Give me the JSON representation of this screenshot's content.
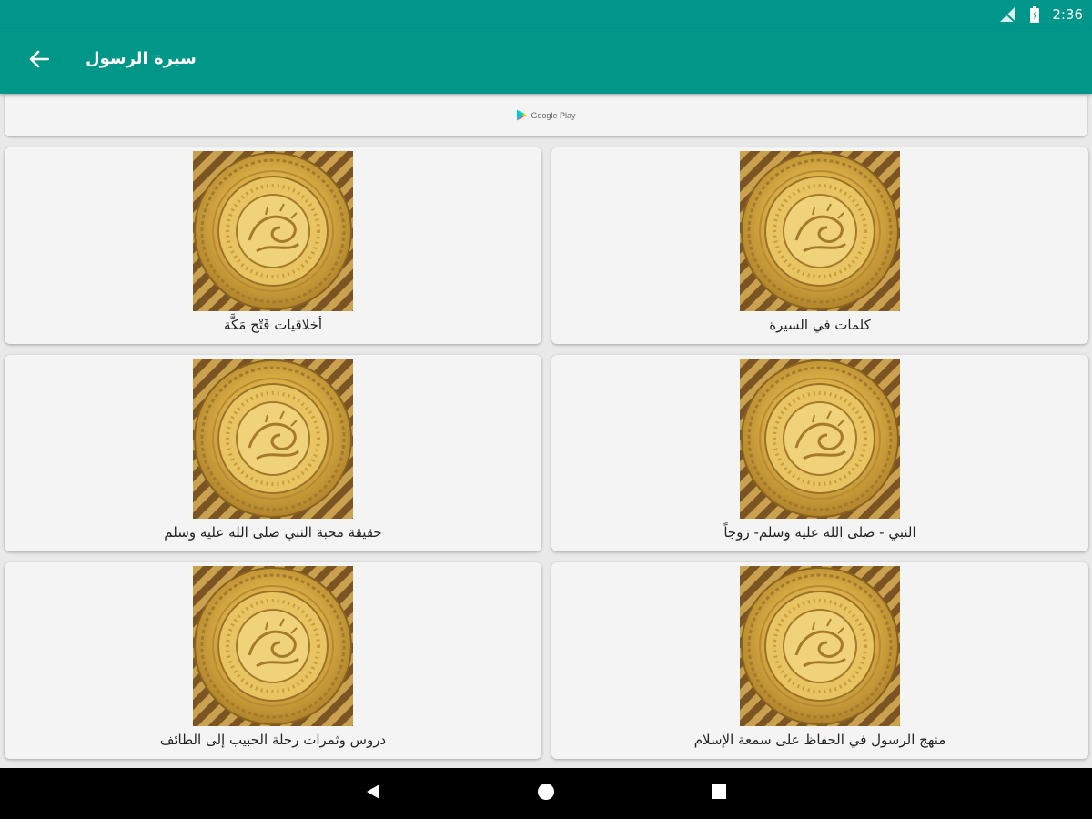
{
  "status": {
    "time": "2:36",
    "icons": [
      "signal-icon",
      "battery-icon"
    ]
  },
  "appbar": {
    "title": "سيرة الرسول",
    "back_icon": "arrow-back-icon"
  },
  "ad": {
    "label": "Google Play",
    "icon": "google-play-icon"
  },
  "colors": {
    "primary": "#009688",
    "gold": "#c9a23c",
    "brown": "#6b4a1f"
  },
  "cards": [
    {
      "title": "كلمات في السيرة",
      "image": "calligraphy-medallion"
    },
    {
      "title": "أخلاقيات فَتْح مَكَّة",
      "image": "calligraphy-medallion"
    },
    {
      "title": "النبي - صلى الله عليه وسلم- زوجاً",
      "image": "calligraphy-medallion"
    },
    {
      "title": "حقيقة محبة النبي صلى الله عليه وسلم",
      "image": "calligraphy-medallion"
    },
    {
      "title": "منهج الرسول في الحفاظ على سمعة الإسلام",
      "image": "calligraphy-medallion"
    },
    {
      "title": "دروس وثمرات رحلة الحبيب إلى الطائف",
      "image": "calligraphy-medallion"
    }
  ],
  "navbar": {
    "icons": [
      "nav-back-icon",
      "nav-home-icon",
      "nav-recents-icon"
    ]
  }
}
